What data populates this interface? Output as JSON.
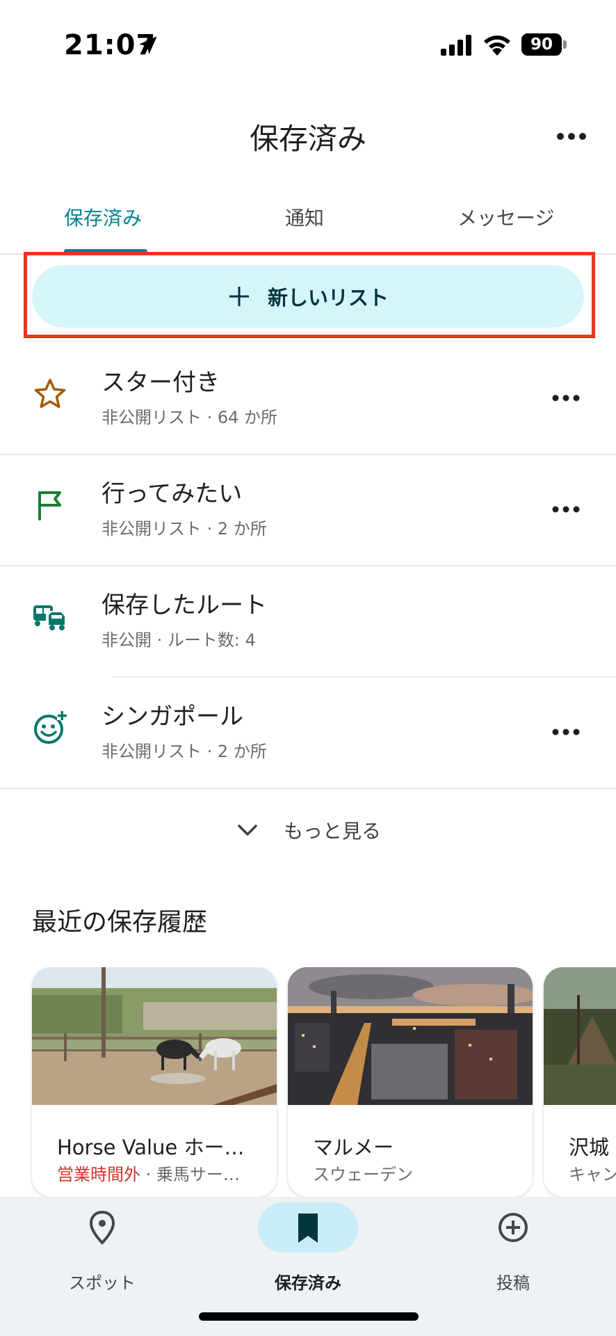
{
  "status": {
    "time": "21:07",
    "battery": "90"
  },
  "header": {
    "title": "保存済み"
  },
  "tabs": [
    {
      "label": "保存済み",
      "active": true
    },
    {
      "label": "通知",
      "active": false
    },
    {
      "label": "メッセージ",
      "active": false
    }
  ],
  "new_list": {
    "label": "新しいリスト"
  },
  "lists": [
    {
      "title": "スター付き",
      "subtitle": "非公開リスト · 64 か所",
      "icon": "star-icon",
      "color": "#a35b00"
    },
    {
      "title": "行ってみたい",
      "subtitle": "非公開リスト · 2 か所",
      "icon": "flag-icon",
      "color": "#1e7b34"
    },
    {
      "title": "保存したルート",
      "subtitle": "非公開 · ルート数: 4",
      "icon": "route-vehicles-icon",
      "color": "#00796b"
    },
    {
      "title": "シンガポール",
      "subtitle": "非公開リスト · 2 か所",
      "icon": "smiley-plus-icon",
      "color": "#00796b"
    }
  ],
  "more": {
    "label": "もっと見る"
  },
  "recent": {
    "title": "最近の保存履歴",
    "cards": [
      {
        "title": "Horse Value ホー…",
        "status": "営業時間外",
        "subtitle": "· 乗馬サー…"
      },
      {
        "title": "マルメー",
        "subtitle": "スウェーデン"
      },
      {
        "title": "沢城",
        "subtitle": "キャン"
      }
    ]
  },
  "bottom_nav": [
    {
      "label": "スポット",
      "icon": "location-pin-icon",
      "active": false
    },
    {
      "label": "保存済み",
      "icon": "bookmark-icon",
      "active": true
    },
    {
      "label": "投稿",
      "icon": "add-circle-icon",
      "active": false
    }
  ],
  "colors": {
    "accent": "#00838f",
    "button_bg": "#d6f5fb",
    "highlight": "#f0321e",
    "closed": "#d93025"
  }
}
